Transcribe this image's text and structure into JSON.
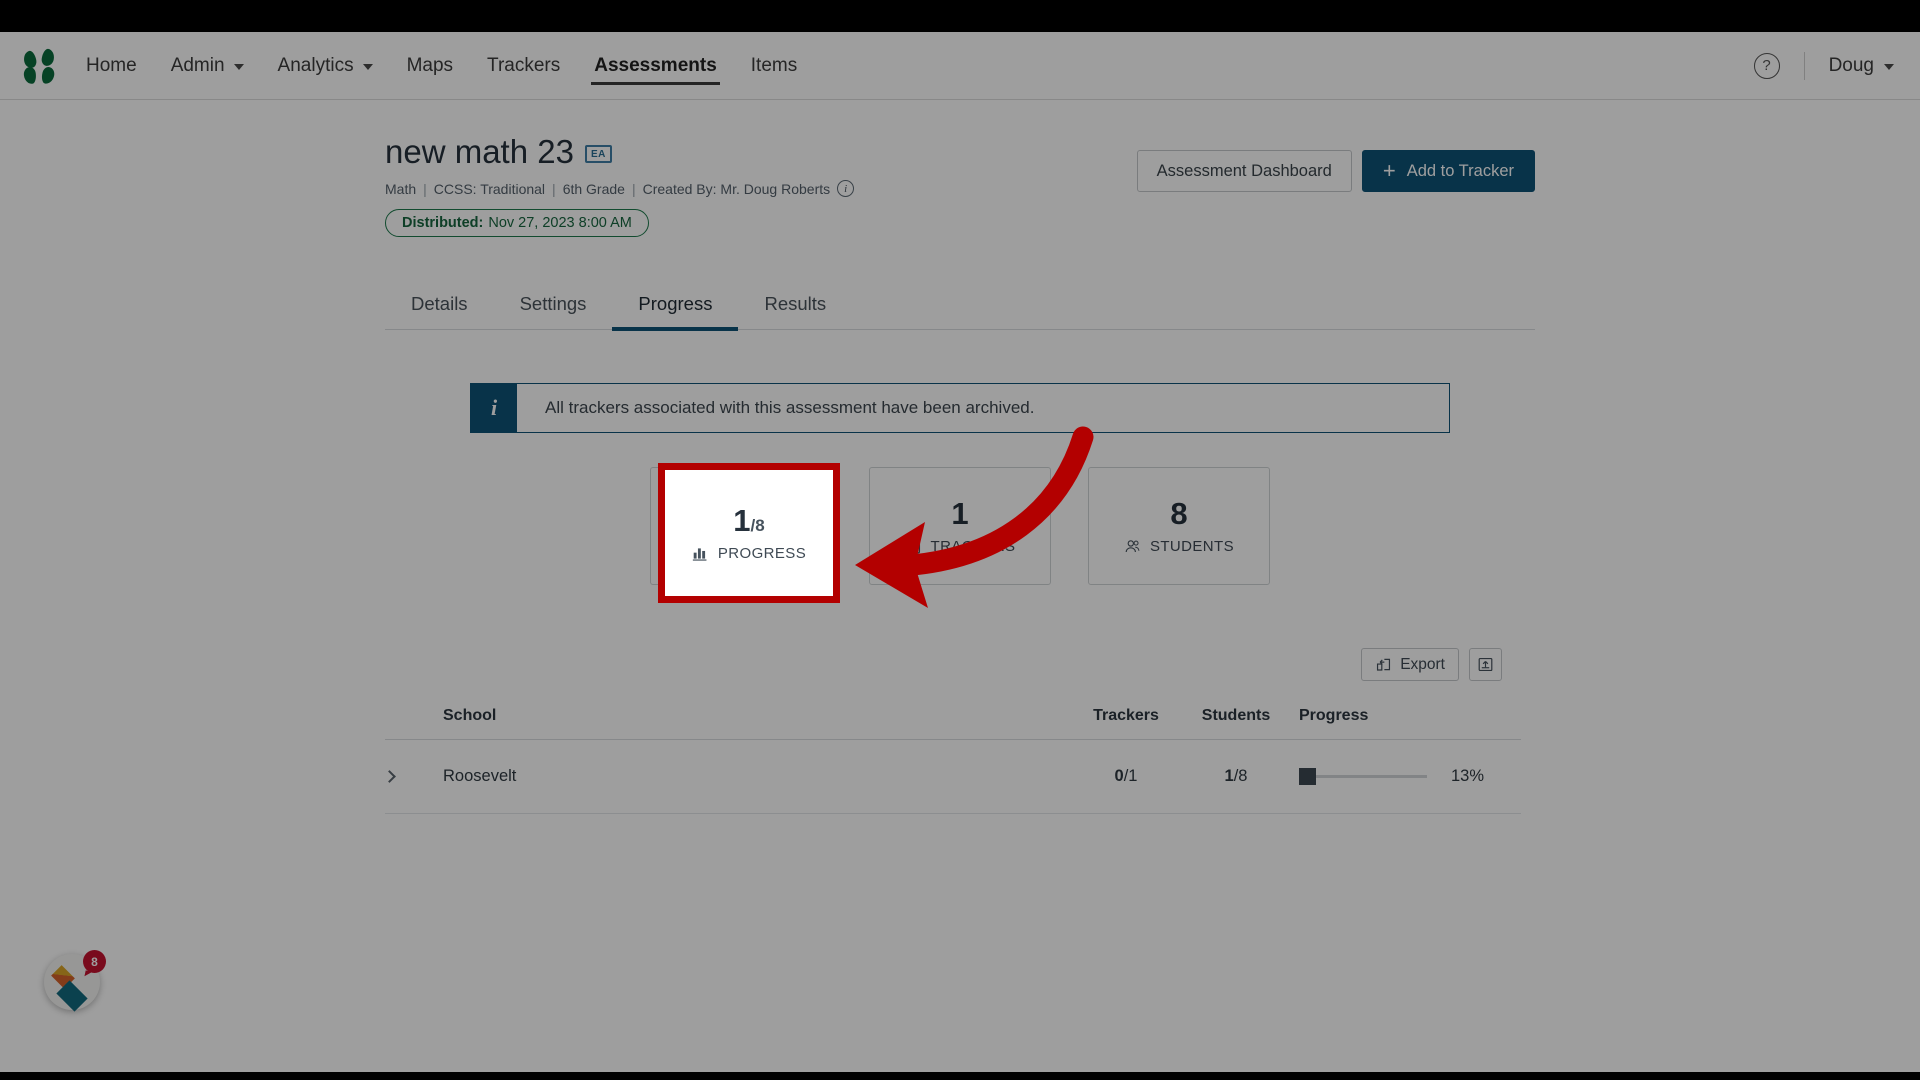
{
  "nav": {
    "logo_icon": "otus-leaf-logo",
    "items": [
      {
        "label": "Home",
        "has_caret": false
      },
      {
        "label": "Admin",
        "has_caret": true
      },
      {
        "label": "Analytics",
        "has_caret": true
      },
      {
        "label": "Maps",
        "has_caret": false
      },
      {
        "label": "Trackers",
        "has_caret": false
      },
      {
        "label": "Assessments",
        "has_caret": false
      },
      {
        "label": "Items",
        "has_caret": false
      }
    ],
    "active_item": "Assessments",
    "help_label": "?",
    "user_label": "Doug"
  },
  "header": {
    "title": "new math 23",
    "badge": "EA",
    "meta": {
      "subject": "Math",
      "standard": "CCSS: Traditional",
      "grade": "6th Grade",
      "creator": "Created By: Mr. Doug Roberts",
      "separator": "|",
      "info_icon": "info-icon"
    },
    "distributed": {
      "label": "Distributed:",
      "value": "Nov 27, 2023 8:00 AM",
      "color": "#18663f"
    },
    "actions": {
      "dashboard_label": "Assessment Dashboard",
      "add_tracker_label": "Add to Tracker",
      "add_tracker_icon": "plus-icon",
      "primary_color": "#0d5377"
    }
  },
  "tabs": [
    {
      "label": "Details",
      "active": false
    },
    {
      "label": "Settings",
      "active": false
    },
    {
      "label": "Progress",
      "active": true
    },
    {
      "label": "Results",
      "active": false
    }
  ],
  "banner": {
    "icon": "info-icon",
    "icon_glyph": "i",
    "message": "All trackers associated with this assessment have been archived.",
    "color": "#0d5377"
  },
  "cards": [
    {
      "value": "1",
      "suffix": "/8",
      "label": "PROGRESS",
      "icon": "bar-chart-icon",
      "highlighted": true
    },
    {
      "value": "1",
      "suffix": "",
      "label": "TRACKERS",
      "icon": "clipboard-icon",
      "highlighted": false
    },
    {
      "value": "8",
      "suffix": "",
      "label": "STUDENTS",
      "icon": "users-icon",
      "highlighted": false
    }
  ],
  "toolbar": {
    "export_label": "Export",
    "export_icon": "export-icon",
    "upload_icon": "upload-box-icon"
  },
  "table": {
    "columns": [
      "School",
      "Trackers",
      "Students",
      "Progress"
    ],
    "rows": [
      {
        "expand_icon": "chevron-right-icon",
        "school": "Roosevelt",
        "trackers_done": "0",
        "trackers_total": "/1",
        "students_done": "1",
        "students_total": "/8",
        "progress_pct": "13%",
        "progress_value": 13
      }
    ]
  },
  "widget": {
    "name": "help-launcher",
    "badge_count": "8"
  },
  "annotation": {
    "highlight_target": "PROGRESS",
    "highlight_color": "#b30000",
    "arrow_color": "#b30000"
  }
}
